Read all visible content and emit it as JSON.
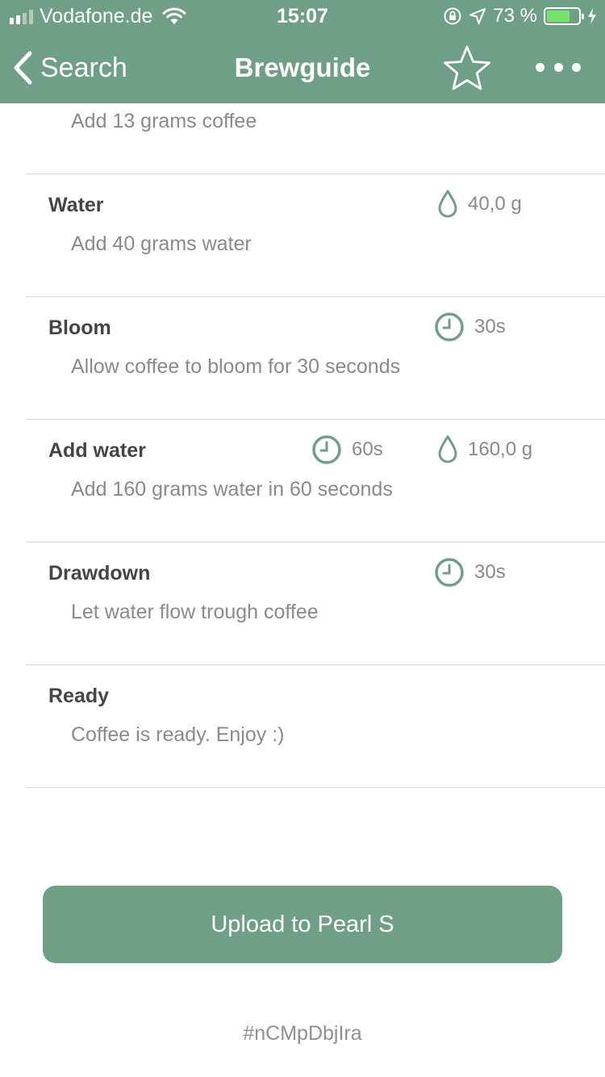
{
  "status_bar": {
    "carrier": "Vodafone.de",
    "time": "15:07",
    "battery": "73 %",
    "battery_level": 0.73,
    "icons": [
      "signal-icon",
      "wifi-icon",
      "orientation-lock-icon",
      "location-icon",
      "battery-icon",
      "charging-icon"
    ]
  },
  "nav": {
    "back_label": "Search",
    "title": "Brewguide",
    "icons": [
      "chevron-left-icon",
      "star-icon",
      "more-icon"
    ]
  },
  "steps": [
    {
      "title": "",
      "description": "Add 13 grams coffee"
    },
    {
      "title": "Water",
      "description": "Add 40 grams water",
      "water": "40,0 g"
    },
    {
      "title": "Bloom",
      "description": "Allow coffee to bloom for 30 seconds",
      "time": "30s"
    },
    {
      "title": "Add water",
      "description": "Add 160 grams water in 60 seconds",
      "time": "60s",
      "water": "160,0 g"
    },
    {
      "title": "Drawdown",
      "description": "Let water flow trough coffee",
      "time": "30s"
    },
    {
      "title": "Ready",
      "description": "Coffee is ready. Enjoy :)"
    }
  ],
  "upload_button": "Upload to Pearl S",
  "hashtag": "#nCMpDbjIra",
  "colors": {
    "accent": "#6f9f86",
    "battery_fill": "#7ae06c",
    "divider": "#d6d6d6"
  }
}
